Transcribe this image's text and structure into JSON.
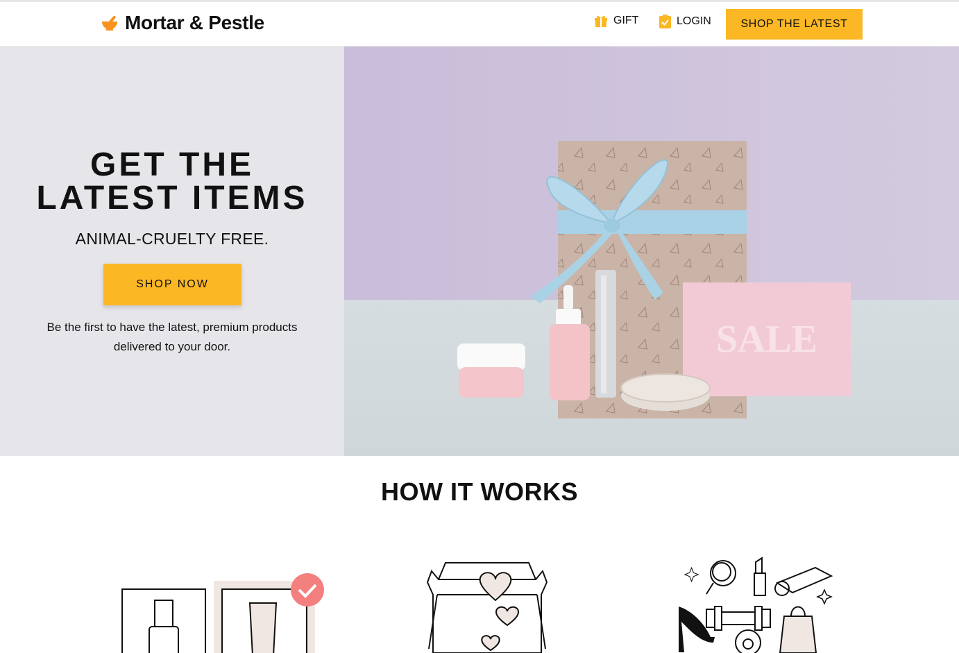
{
  "header": {
    "brand": "Mortar & Pestle",
    "nav": {
      "gift_label": "GIFT",
      "login_label": "LOGIN",
      "shop_latest_label": "SHOP THE LATEST"
    }
  },
  "hero": {
    "title_line1": "GET THE",
    "title_line2": "LATEST ITEMS",
    "subtitle": "ANIMAL-CRUELTY FREE.",
    "cta_label": "SHOP NOW",
    "description_line1": "Be the first to have the latest, premium products",
    "description_line2": "delivered to your door.",
    "image_card_text": "SALE"
  },
  "how_it_works": {
    "title": "HOW IT WORKS"
  },
  "colors": {
    "accent": "#fbb724",
    "hero_left_bg": "#e6e5ea",
    "hero_photo_wall": "#cdc2dc",
    "check_badge": "#f47f7f"
  },
  "icons": [
    "mortar-pestle-logo-icon",
    "gift-icon",
    "clipboard-check-icon"
  ]
}
